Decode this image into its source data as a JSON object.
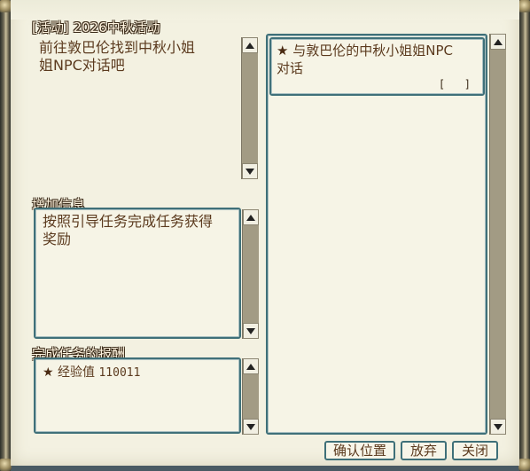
{
  "quest": {
    "title": "[活动] 2026中秋活动",
    "description": "前往敦巴伦找到中秋小姐姐NPC对话吧",
    "description_lines": [
      "前往敦巴伦找到中秋小姐",
      "姐NPC对话吧"
    ]
  },
  "additional_info": {
    "label": "增加信息",
    "lines": [
      "按照引导任务完成任务获得",
      "奖励"
    ]
  },
  "reward": {
    "label": "完成任务的报酬",
    "star": "★",
    "item_label": "经验值",
    "item_value": "110011"
  },
  "objective": {
    "star": "★",
    "lines": [
      "与敦巴伦的中秋小姐姐NPC",
      "对话"
    ],
    "progress": "[   ]"
  },
  "buttons": {
    "locate": "确认位置",
    "abandon": "放弃",
    "close": "关闭"
  },
  "colors": {
    "panel_border": "#3f7079",
    "text": "#5b3a1e",
    "paper": "#f3f1e1"
  }
}
